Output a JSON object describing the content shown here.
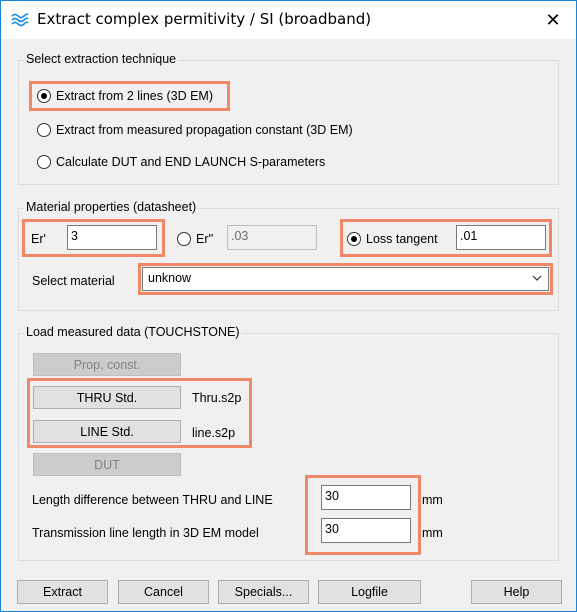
{
  "window": {
    "title": "Extract complex permitivity / SI (broadband)",
    "close_glyph": "✕",
    "icon": "wave-icon"
  },
  "technique": {
    "group_label": "Select extraction technique",
    "options": [
      {
        "label": "Extract from 2 lines (3D EM)",
        "selected": true
      },
      {
        "label": "Extract from measured propagation constant (3D EM)",
        "selected": false
      },
      {
        "label": "Calculate DUT and END LAUNCH S-parameters",
        "selected": false
      }
    ]
  },
  "material": {
    "group_label": "Material properties (datasheet)",
    "er_label": "Er'",
    "er_value": "3",
    "er2_label": "Er''",
    "er2_value": ".03",
    "er2_selected": false,
    "loss_label": "Loss tangent",
    "loss_value": ".01",
    "loss_selected": true,
    "select_label": "Select material",
    "select_value": "unknow"
  },
  "load": {
    "group_label": "Load measured data (TOUCHSTONE)",
    "prop_const_label": "Prop. const.",
    "thru_label": "THRU Std.",
    "thru_file": "Thru.s2p",
    "line_label": "LINE Std.",
    "line_file": "line.s2p",
    "dut_label": "DUT",
    "length_diff_label": "Length difference between THRU and LINE",
    "length_diff_value": "30",
    "length_diff_unit": "mm",
    "tl_length_label": "Transmission line length in 3D EM model",
    "tl_length_value": "30",
    "tl_length_unit": "mm"
  },
  "footer": {
    "extract_label": "Extract",
    "cancel_label": "Cancel",
    "specials_label": "Specials...",
    "logfile_label": "Logfile",
    "help_label": "Help"
  },
  "colors": {
    "highlight": "#f08868",
    "window_border": "#1883d7"
  }
}
